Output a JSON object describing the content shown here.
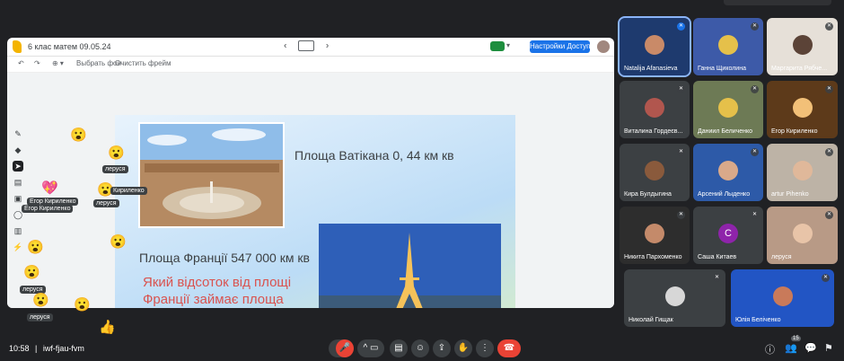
{
  "jam": {
    "title": "6 клас матем 09.05.24",
    "prev_icon": "‹",
    "next_icon": "›",
    "access_button": "Настройки Доступа",
    "caret": "▾",
    "tool_undo": "↶",
    "tool_redo": "↷",
    "tool_zoom": "⊕ ▾",
    "tool_set_bg": "Выбрать фон",
    "tool_clear": "Очистить фрейм",
    "side_tools": [
      "✎",
      "◆",
      "➤",
      "▤",
      "▣",
      "◯",
      "▥",
      "⚡"
    ]
  },
  "slide": {
    "vatican_area": "Площа Ватікана 0, 44 км кв",
    "france_area": "Площа Франції 547 000 км кв",
    "question": "Який відсоток від площі Франції займає площа Ватікана?"
  },
  "reactions": {
    "names": [
      "леруся",
      "Кириленко",
      "Егор Кириленко",
      "Егор Кириленко",
      "леруся",
      "леруся",
      "леруся"
    ],
    "emojis": [
      "😮",
      "😮",
      "😮",
      "😮",
      "😮",
      "😮",
      "😮",
      "💖",
      "👍"
    ]
  },
  "participants": [
    {
      "name": "Natalija Afanasieva",
      "color": "#1e3a6e",
      "mic": "✕"
    },
    {
      "name": "Ганна Щиколина",
      "color": "#3d5aa8",
      "mic": "✕"
    },
    {
      "name": "Маргарита Рябче...",
      "color": "#e6e0d8",
      "mic": "✕"
    },
    {
      "name": "Виталина Гордеєв...",
      "color": "#3c4043",
      "mic": "✕"
    },
    {
      "name": "Даниил Беличенко",
      "color": "#6d7a55",
      "mic": "✕"
    },
    {
      "name": "Егор Кириленко",
      "color": "#5d3a1a",
      "mic": "✕"
    },
    {
      "name": "Кира Булдыгина",
      "color": "#3c4043",
      "mic": "✕"
    },
    {
      "name": "Арсений Лыденко",
      "color": "#2d5aa8",
      "mic": "✕"
    },
    {
      "name": "artur Pihenko",
      "color": "#bdb3a6",
      "mic": "✕"
    },
    {
      "name": "Никита Пархоменко",
      "color": "#2d2d2d",
      "mic": "✕"
    },
    {
      "name": "Саша Китаев",
      "color": "#3c4043",
      "initial": "С",
      "mic": "✕"
    },
    {
      "name": "леруся",
      "color": "#b89a86",
      "mic": "✕"
    },
    {
      "name": "Николай Гищак",
      "color": "#3c4043",
      "mic": "✕"
    },
    {
      "name": "Юлія Беліченко",
      "color": "#2255c4",
      "mic": "✕"
    }
  ],
  "bottom": {
    "time": "10:58",
    "separator": "|",
    "meeting_code": "iwf-fjau-fvm",
    "people_count": "15",
    "buttons": [
      "^",
      "🎤",
      "^",
      "▭",
      "▤",
      "☺",
      "⇪",
      "✋",
      "⋮",
      "☎"
    ],
    "right_icons": [
      "ⓘ",
      "👥",
      "💬",
      "⚑"
    ]
  },
  "colors": {
    "background": "#202124",
    "accent": "#1a73e8",
    "end_call": "#ea4335"
  }
}
